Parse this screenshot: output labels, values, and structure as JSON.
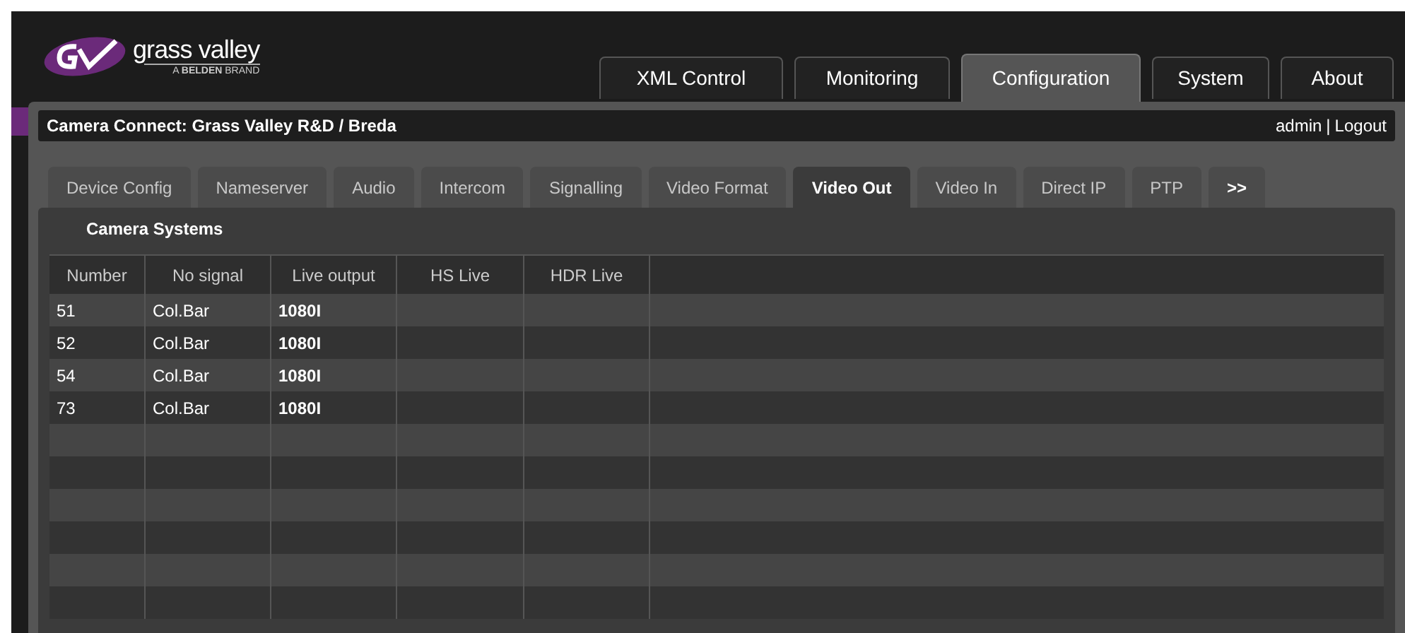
{
  "logo": {
    "wordmark": "grass valley",
    "tagline": "A **BELDEN** BRAND"
  },
  "main_tabs": [
    {
      "label": "XML Control",
      "selected": false
    },
    {
      "label": "Monitoring",
      "selected": false
    },
    {
      "label": "Configuration",
      "selected": true
    },
    {
      "label": "System",
      "selected": false
    },
    {
      "label": "About",
      "selected": false
    }
  ],
  "title_bar": {
    "title": "Camera Connect: Grass Valley R&D / Breda",
    "user": "admin",
    "separator": "|",
    "logout": "Logout"
  },
  "sub_tabs": [
    {
      "label": "Device Config",
      "selected": false
    },
    {
      "label": "Nameserver",
      "selected": false
    },
    {
      "label": "Audio",
      "selected": false
    },
    {
      "label": "Intercom",
      "selected": false
    },
    {
      "label": "Signalling",
      "selected": false
    },
    {
      "label": "Video Format",
      "selected": false
    },
    {
      "label": "Video Out",
      "selected": true
    },
    {
      "label": "Video In",
      "selected": false
    },
    {
      "label": "Direct IP",
      "selected": false
    },
    {
      "label": "PTP",
      "selected": false
    },
    {
      "label": ">>",
      "selected": false
    }
  ],
  "section_title": "Camera Systems",
  "table": {
    "columns": [
      "Number",
      "No signal",
      "Live output",
      "HS Live",
      "HDR Live"
    ],
    "rows": [
      [
        "51",
        "Col.Bar",
        "1080I",
        "",
        ""
      ],
      [
        "52",
        "Col.Bar",
        "1080I",
        "",
        ""
      ],
      [
        "54",
        "Col.Bar",
        "1080I",
        "",
        ""
      ],
      [
        "73",
        "Col.Bar",
        "1080I",
        "",
        ""
      ]
    ]
  }
}
